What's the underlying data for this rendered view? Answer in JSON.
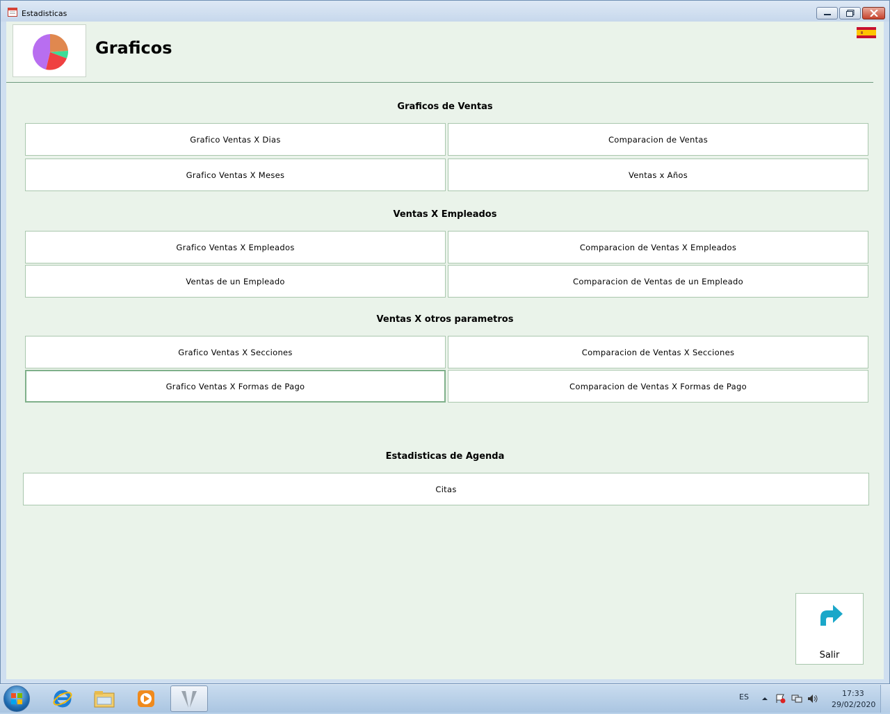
{
  "window": {
    "title": "Estadisticas"
  },
  "header": {
    "title": "Graficos"
  },
  "sections": [
    {
      "title": "Graficos de Ventas",
      "buttons": [
        "Grafico Ventas X Dias",
        "Comparacion de Ventas",
        "Grafico Ventas X Meses",
        "Ventas x Años"
      ]
    },
    {
      "title": "Ventas X Empleados",
      "buttons": [
        "Grafico Ventas X Empleados",
        "Comparacion de Ventas X Empleados",
        "Ventas de un Empleado",
        "Comparacion de Ventas de un Empleado"
      ]
    },
    {
      "title": "Ventas X otros parametros",
      "buttons": [
        "Grafico Ventas X Secciones",
        "Comparacion de Ventas X Secciones",
        "Grafico Ventas X Formas de Pago",
        "Comparacion de Ventas X Formas de Pago"
      ]
    },
    {
      "title": "Estadisticas de Agenda",
      "buttons": [
        "Citas"
      ]
    }
  ],
  "exit": {
    "label": "Salir"
  },
  "taskbar": {
    "language": "ES",
    "time": "17:33",
    "date": "29/02/2020"
  },
  "colors": {
    "client_bg": "#eaf3ea",
    "accent_exit_arrow": "#1aa7c9",
    "button_border": "#a9c7ad"
  }
}
